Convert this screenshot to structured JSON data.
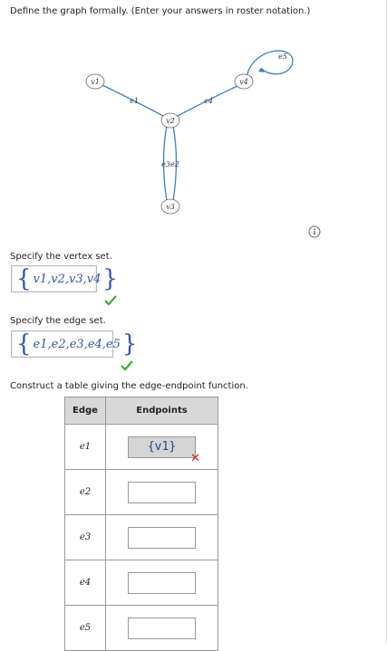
{
  "instruction": "Define the graph formally. (Enter your answers in roster notation.)",
  "graph": {
    "vertices": [
      "v1",
      "v2",
      "v3",
      "v4"
    ],
    "edge_labels": [
      "e1",
      "e2",
      "e3",
      "e4",
      "e5"
    ],
    "e3e2_label": "e3e2",
    "edge_color": "#3b7fc4"
  },
  "info_icon": "info-circle-icon",
  "vertex_section": {
    "label": "Specify the vertex set.",
    "answer": "v1,v2,v3,v4",
    "status": "correct"
  },
  "edge_section": {
    "label": "Specify the edge set.",
    "answer": "e1,e2,e3,e4,e5",
    "status": "correct"
  },
  "table_section": {
    "label": "Construct a table giving the edge-endpoint function.",
    "headers": {
      "edge": "Edge",
      "endpoints": "Endpoints"
    },
    "rows": [
      {
        "edge": "e1",
        "value": "{v1}",
        "status": "incorrect"
      },
      {
        "edge": "e2",
        "value": "",
        "status": ""
      },
      {
        "edge": "e3",
        "value": "",
        "status": ""
      },
      {
        "edge": "e4",
        "value": "",
        "status": ""
      },
      {
        "edge": "e5",
        "value": "",
        "status": ""
      }
    ]
  },
  "colors": {
    "correct": "#44aa33",
    "incorrect": "#cc2222",
    "math": "#3355aa"
  }
}
